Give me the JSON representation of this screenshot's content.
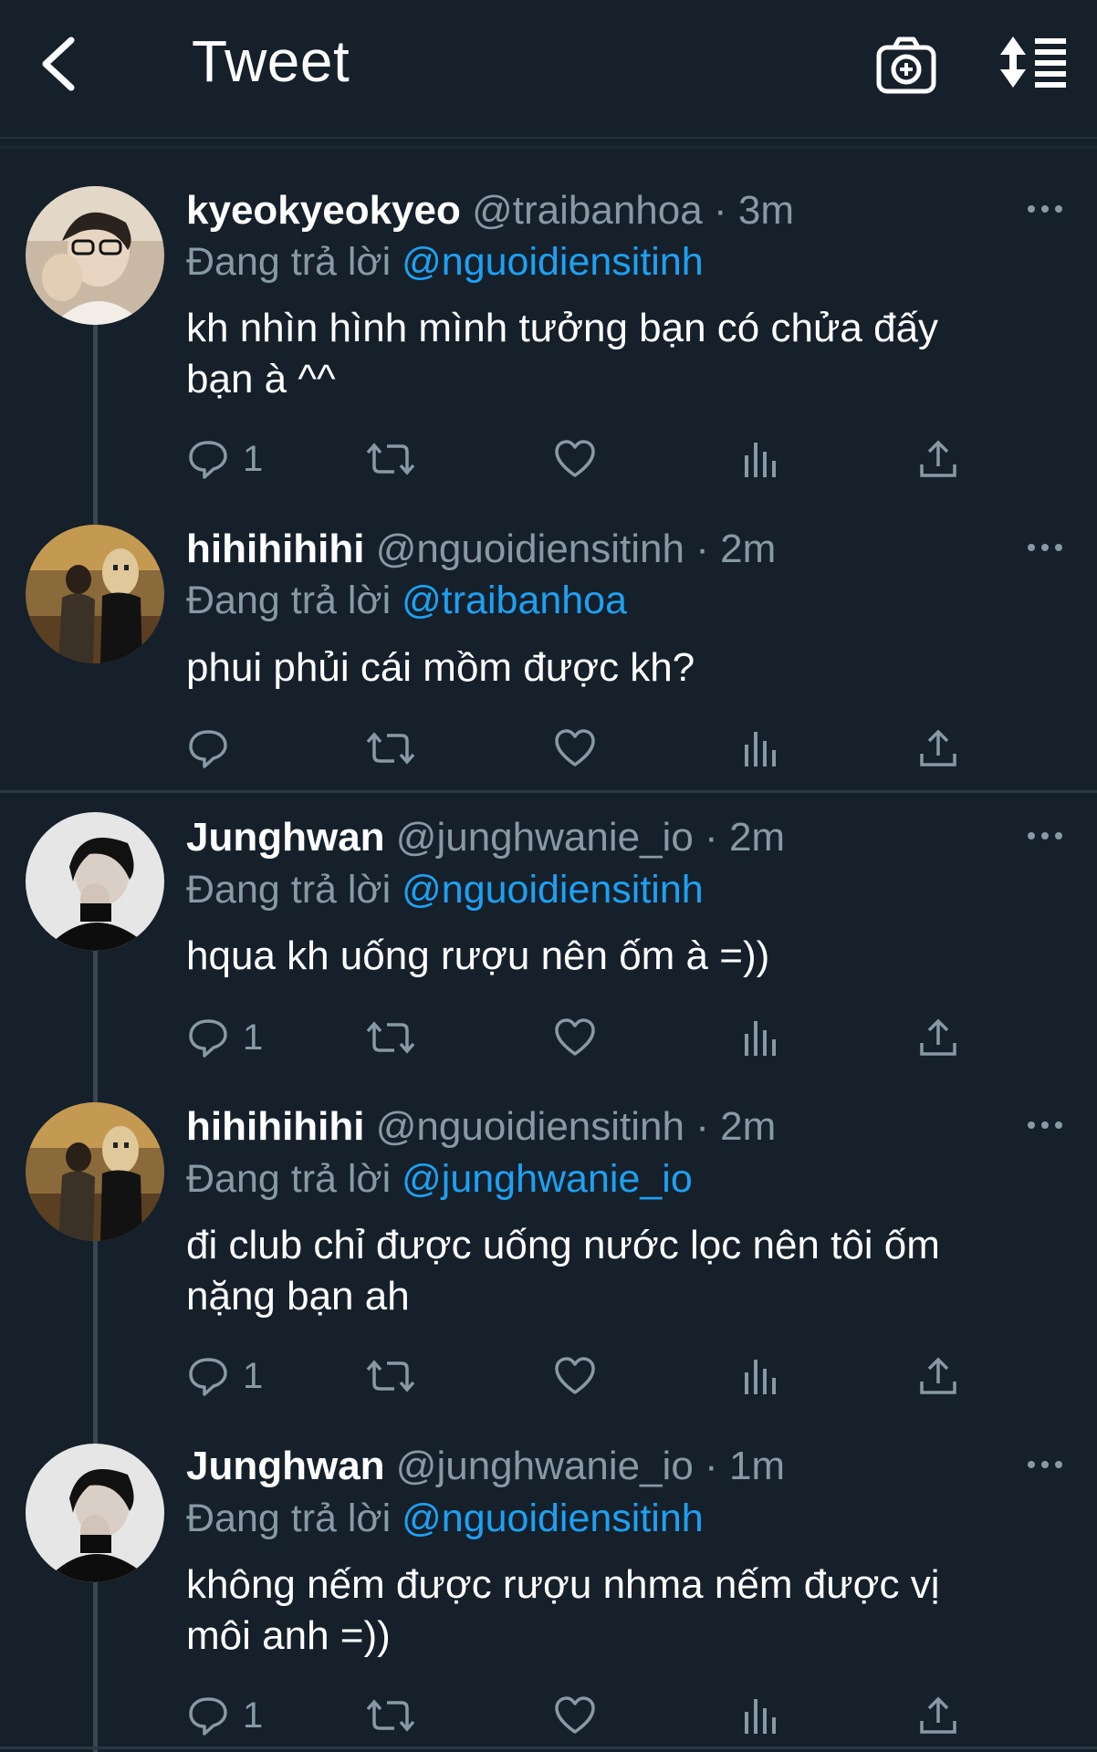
{
  "header": {
    "title": "Tweet",
    "icons": [
      "back-arrow-icon",
      "camera-plus-icon",
      "sort-list-icon"
    ]
  },
  "colors": {
    "background": "#15202b",
    "text_primary": "#ffffff",
    "text_secondary": "#8899a6",
    "accent": "#1da1f2"
  },
  "tweets": [
    {
      "name": "kyeokyeokyeo",
      "handle": "@traibanhoa",
      "sep": "·",
      "time": "3m",
      "reply_prefix": "Đang trả lời",
      "reply_to": "@nguoidiensitinh",
      "text": "kh nhìn hình mình tưởng bạn có chửa đấy bạn à ^^",
      "reply_count": "1"
    },
    {
      "name": "hihihihihi",
      "handle": "@nguoidiensitinh",
      "sep": "·",
      "time": "2m",
      "reply_prefix": "Đang trả lời",
      "reply_to": "@traibanhoa",
      "text": "phui phủi cái mồm được kh?",
      "reply_count": ""
    },
    {
      "name": "Junghwan",
      "handle": "@junghwanie_io",
      "sep": "·",
      "time": "2m",
      "reply_prefix": "Đang trả lời",
      "reply_to": "@nguoidiensitinh",
      "text": "hqua kh uống rượu nên ốm à =))",
      "reply_count": "1"
    },
    {
      "name": "hihihihihi",
      "handle": "@nguoidiensitinh",
      "sep": "·",
      "time": "2m",
      "reply_prefix": "Đang trả lời",
      "reply_to": "@junghwanie_io",
      "text": "đi club chỉ được uống nước lọc nên tôi ốm nặng bạn ah",
      "reply_count": "1"
    },
    {
      "name": "Junghwan",
      "handle": "@junghwanie_io",
      "sep": "·",
      "time": "1m",
      "reply_prefix": "Đang trả lời",
      "reply_to": "@nguoidiensitinh",
      "text": "không nếm được rượu nhma nếm được vị môi anh =))",
      "reply_count": "1"
    }
  ]
}
